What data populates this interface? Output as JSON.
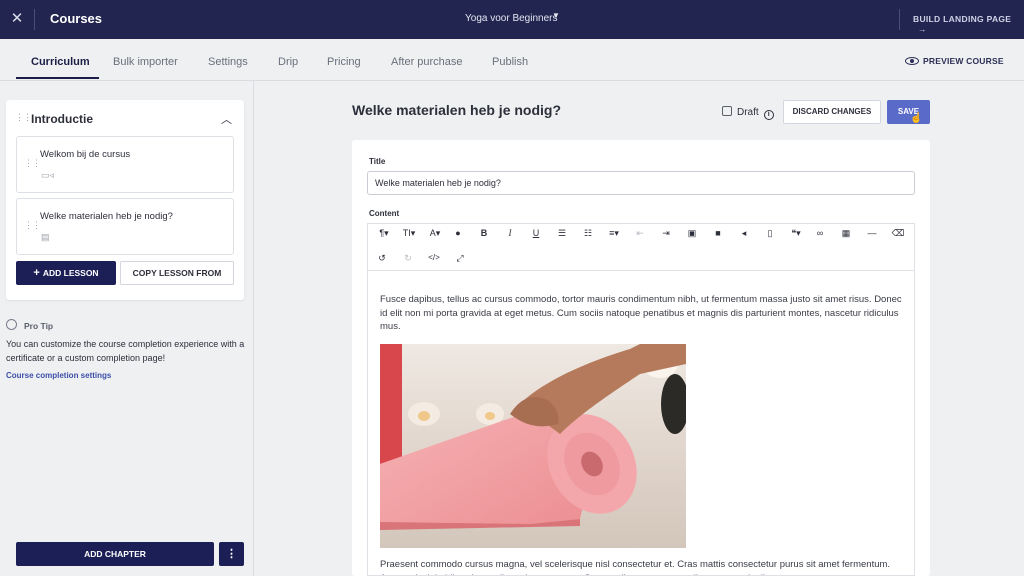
{
  "topbar": {
    "close_icon": "close-icon",
    "title": "Courses",
    "course_name": "Yoga voor Beginners",
    "build_landing": "BUILD LANDING PAGE"
  },
  "tabs": [
    {
      "label": "Curriculum",
      "active": true
    },
    {
      "label": "Bulk importer"
    },
    {
      "label": "Settings"
    },
    {
      "label": "Drip"
    },
    {
      "label": "Pricing"
    },
    {
      "label": "After purchase"
    },
    {
      "label": "Publish"
    }
  ],
  "preview_label": "PREVIEW COURSE",
  "sidebar": {
    "chapter_title": "Introductie",
    "lessons": [
      {
        "name": "Welkom bij de cursus",
        "icon": "video-icon"
      },
      {
        "name": "Welke materialen heb je nodig?",
        "icon": "document-icon"
      }
    ],
    "add_lesson": "ADD LESSON",
    "copy_lesson": "COPY LESSON FROM",
    "protip_title": "Pro Tip",
    "protip_text": "You can customize the course completion experience with a certificate or a custom completion page!",
    "protip_link": "Course completion settings",
    "add_chapter": "ADD CHAPTER"
  },
  "main": {
    "lesson_heading": "Welke materialen heb je nodig?",
    "draft_label": "Draft",
    "discard_label": "DISCARD CHANGES",
    "save_label": "SAVE",
    "title_label": "Title",
    "title_value": "Welke materialen heb je nodig?",
    "content_label": "Content",
    "paragraph1": "Fusce dapibus, tellus ac cursus commodo, tortor mauris condimentum nibh, ut fermentum massa justo sit amet risus. Donec id elit non mi porta gravida at eget metus. Cum sociis natoque penatibus et magnis dis parturient montes, nascetur ridiculus mus.",
    "paragraph2": "Praesent commodo cursus magna, vel scelerisque nisl consectetur et. Cras mattis consectetur purus sit amet fermentum. Aenean lacinia bibendum nulla sed consectetur. Cum sociis natoque penatibus et magnis dis"
  },
  "colors": {
    "topbar": "#22254f",
    "primary_button": "#1c1f56",
    "save_button": "#5a6ac8",
    "link": "#3d4fa8"
  }
}
